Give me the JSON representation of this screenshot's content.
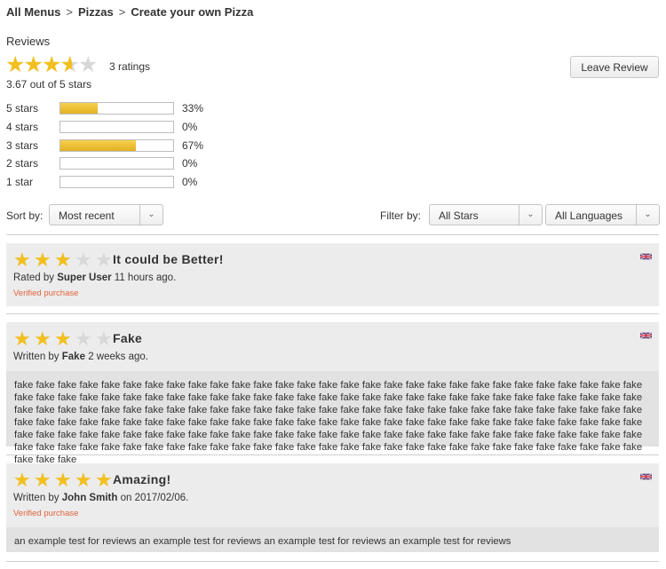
{
  "breadcrumb": {
    "items": [
      "All Menus",
      "Pizzas",
      "Create your own Pizza"
    ],
    "separator": ">"
  },
  "reviews_header": {
    "title": "Reviews",
    "average_stars": 3.67,
    "rating_count_text": "3 ratings",
    "average_text": "3.67 out of 5 stars",
    "leave_review_label": "Leave Review"
  },
  "distribution": [
    {
      "label": "5 stars",
      "percent": 33,
      "percent_text": "33%"
    },
    {
      "label": "4 stars",
      "percent": 0,
      "percent_text": "0%"
    },
    {
      "label": "3 stars",
      "percent": 67,
      "percent_text": "67%"
    },
    {
      "label": "2 stars",
      "percent": 0,
      "percent_text": "0%"
    },
    {
      "label": "1 star",
      "percent": 0,
      "percent_text": "0%"
    }
  ],
  "controls": {
    "sort_label": "Sort by:",
    "sort_value": "Most recent",
    "filter_label": "Filter by:",
    "filter_stars_value": "All Stars",
    "filter_language_value": "All Languages",
    "arrow_icon": "chevron-down-icon"
  },
  "colors": {
    "star_filled": "#f2c01e",
    "star_empty": "#d8d8d8",
    "verified": "#e0643c",
    "review_bg": "#ececec",
    "review_body_bg": "#e2e2e2"
  },
  "reviews": [
    {
      "stars": 3,
      "title": "It could be Better!",
      "meta_prefix": "Rated by",
      "author": "Super User",
      "meta_suffix": "11 hours ago.",
      "verified_text": "Verified purchase",
      "body": "",
      "flag_icon": "uk-flag-icon"
    },
    {
      "stars": 3,
      "title": "Fake",
      "meta_prefix": "Written by",
      "author": "Fake",
      "meta_suffix": "2 weeks ago.",
      "verified_text": "",
      "body": "fake fake fake fake fake fake fake fake fake fake fake fake fake fake fake fake fake fake fake fake fake fake fake fake fake fake fake fake fake fake fake fake fake fake fake fake fake fake fake fake fake fake fake fake fake fake fake fake fake fake fake fake fake fake fake fake fake fake fake fake fake fake fake fake fake fake fake fake fake fake fake fake fake fake fake fake fake fake fake fake fake fake fake fake fake fake fake fake fake fake fake fake fake fake fake fake fake fake fake fake fake fake fake fake fake fake fake fake fake fake fake fake fake fake fake fake fake fake fake fake fake fake fake fake fake fake fake fake fake fake fake fake fake fake fake fake fake fake fake fake fake fake fake fake fake fake fake fake fake fake fake fake fake fake fake fake fake fake fake fake fake fake fake fake fake fake fake fake fake fake fake fake fake fake fake fake fake",
      "flag_icon": "uk-flag-icon"
    },
    {
      "stars": 5,
      "title": "Amazing!",
      "meta_prefix": "Written by",
      "author": "John Smith",
      "meta_suffix": "on 2017/02/06.",
      "verified_text": "Verified purchase",
      "body": "an example test for reviews an example test for reviews an example test for reviews an example test for reviews",
      "flag_icon": "uk-flag-icon"
    }
  ]
}
